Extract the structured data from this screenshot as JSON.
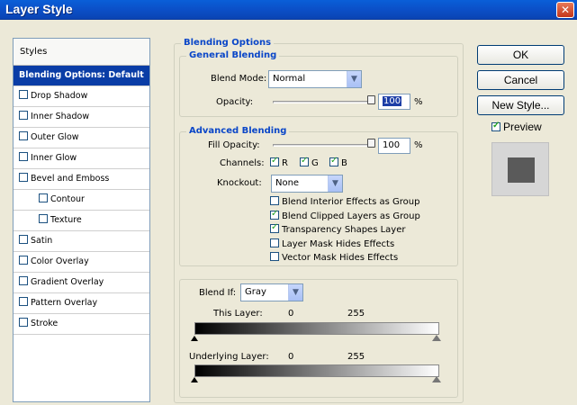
{
  "window": {
    "title": "Layer Style",
    "close_glyph": "✕"
  },
  "styles_panel": {
    "header": "Styles",
    "items": [
      {
        "label": "Blending Options: Default",
        "selected": true,
        "checkbox": false
      },
      {
        "label": "Drop Shadow",
        "checkbox": true,
        "checked": false
      },
      {
        "label": "Inner Shadow",
        "checkbox": true,
        "checked": false
      },
      {
        "label": "Outer Glow",
        "checkbox": true,
        "checked": false
      },
      {
        "label": "Inner Glow",
        "checkbox": true,
        "checked": false
      },
      {
        "label": "Bevel and Emboss",
        "checkbox": true,
        "checked": false
      },
      {
        "label": "Contour",
        "checkbox": true,
        "checked": false,
        "sub": true
      },
      {
        "label": "Texture",
        "checkbox": true,
        "checked": false,
        "sub": true
      },
      {
        "label": "Satin",
        "checkbox": true,
        "checked": false
      },
      {
        "label": "Color Overlay",
        "checkbox": true,
        "checked": false
      },
      {
        "label": "Gradient Overlay",
        "checkbox": true,
        "checked": false
      },
      {
        "label": "Pattern Overlay",
        "checkbox": true,
        "checked": false
      },
      {
        "label": "Stroke",
        "checkbox": true,
        "checked": false
      }
    ]
  },
  "blending": {
    "title": "Blending Options",
    "general": {
      "title": "General Blending",
      "blend_mode_label": "Blend Mode:",
      "blend_mode_value": "Normal",
      "opacity_label": "Opacity:",
      "opacity_value": "100",
      "opacity_fraction": 1.0,
      "percent": "%"
    },
    "advanced": {
      "title": "Advanced Blending",
      "fill_opacity_label": "Fill Opacity:",
      "fill_opacity_value": "100",
      "fill_opacity_fraction": 1.0,
      "percent": "%",
      "channels_label": "Channels:",
      "channel_r": "R",
      "channel_g": "G",
      "channel_b": "B",
      "knockout_label": "Knockout:",
      "knockout_value": "None",
      "options": [
        {
          "label": "Blend Interior Effects as Group",
          "checked": false
        },
        {
          "label": "Blend Clipped Layers as Group",
          "checked": true
        },
        {
          "label": "Transparency Shapes Layer",
          "checked": true
        },
        {
          "label": "Layer Mask Hides Effects",
          "checked": false
        },
        {
          "label": "Vector Mask Hides Effects",
          "checked": false
        }
      ]
    },
    "blend_if": {
      "label": "Blend If:",
      "value": "Gray",
      "this_layer_label": "This Layer:",
      "this_layer_min": "0",
      "this_layer_max": "255",
      "underlying_label": "Underlying Layer:",
      "underlying_min": "0",
      "underlying_max": "255"
    }
  },
  "buttons": {
    "ok": "OK",
    "cancel": "Cancel",
    "new_style": "New Style...",
    "preview_label": "Preview",
    "preview_checked": true
  },
  "colors": {
    "titlebar": "#0b4ec6",
    "selection": "#0a3da6",
    "group_title": "#0a46c8",
    "checkmark": "#21a121",
    "preview_swatch": "#5a5a5a"
  }
}
